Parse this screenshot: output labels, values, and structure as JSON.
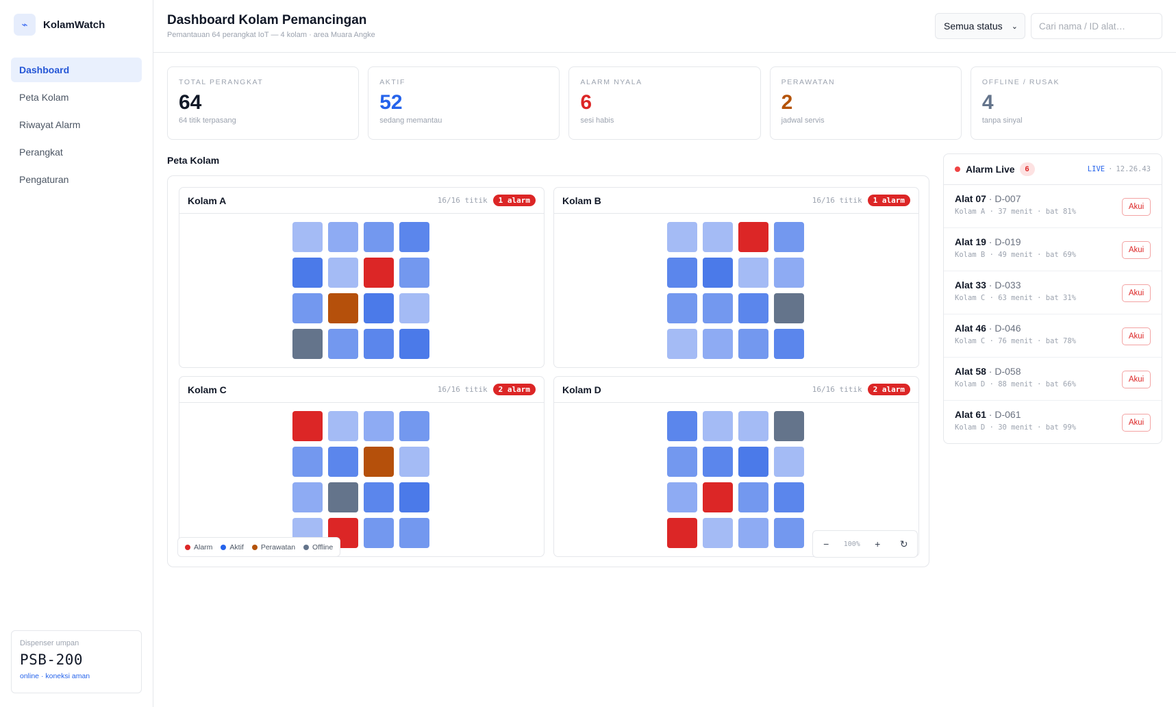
{
  "brand": {
    "name": "KolamWatch",
    "logo_icon": "wave-icon"
  },
  "sidebar": {
    "items": [
      {
        "label": "Dashboard",
        "active": true
      },
      {
        "label": "Peta Kolam"
      },
      {
        "label": "Riwayat Alarm"
      },
      {
        "label": "Perangkat"
      },
      {
        "label": "Pengaturan"
      }
    ],
    "dispenser": {
      "label": "Dispenser umpan",
      "model": "PSB-200",
      "status": "online · koneksi aman"
    }
  },
  "header": {
    "title": "Dashboard Kolam Pemancingan",
    "subtitle": "Pemantauan 64 perangkat IoT — 4 kolam · area Muara Angke",
    "status_filter": "Semua status",
    "search_placeholder": "Cari nama / ID alat…"
  },
  "stats": [
    {
      "label": "TOTAL PERANGKAT",
      "value": "64",
      "desc": "64 titik terpasang",
      "color": "#111827"
    },
    {
      "label": "AKTIF",
      "value": "52",
      "desc": "sedang memantau",
      "color": "#2563eb"
    },
    {
      "label": "ALARM NYALA",
      "value": "6",
      "desc": "sesi habis",
      "color": "#dc2626"
    },
    {
      "label": "PERAWATAN",
      "value": "2",
      "desc": "jadwal servis",
      "color": "#b45309"
    },
    {
      "label": "OFFLINE / RUSAK",
      "value": "4",
      "desc": "tanpa sinyal",
      "color": "#64748b"
    }
  ],
  "map": {
    "title": "Peta Kolam",
    "colors": {
      "alarm": "#dc2626",
      "maintenance": "#b5500b",
      "offline": "#64748b",
      "active_1": "#a4bbf5",
      "active_2": "#8eabf3",
      "active_3": "#7398ef",
      "active_4": "#5b86ec",
      "active_5": "#4b7ae9"
    },
    "ponds": [
      {
        "name": "Kolam A",
        "count": "16/16 titik",
        "badge": "1 alarm",
        "cells": [
          "a1",
          "a2",
          "a3",
          "a4",
          "a5",
          "a1",
          "alarm",
          "a3",
          "a3",
          "maint",
          "a5",
          "a1",
          "offline",
          "a3",
          "a4",
          "a5"
        ]
      },
      {
        "name": "Kolam B",
        "count": "16/16 titik",
        "badge": "1 alarm",
        "cells": [
          "a1",
          "a1",
          "alarm",
          "a3",
          "a4",
          "a5",
          "a1",
          "a2",
          "a3",
          "a3",
          "a4",
          "offline",
          "a1",
          "a2",
          "a3",
          "a4"
        ]
      },
      {
        "name": "Kolam C",
        "count": "16/16 titik",
        "badge": "2 alarm",
        "cells": [
          "alarm",
          "a1",
          "a2",
          "a3",
          "a3",
          "a4",
          "maint",
          "a1",
          "a2",
          "offline",
          "a4",
          "a5",
          "a1",
          "alarm",
          "a3",
          "a3"
        ]
      },
      {
        "name": "Kolam D",
        "count": "16/16 titik",
        "badge": "2 alarm",
        "cells": [
          "a4",
          "a1",
          "a1",
          "offline",
          "a3",
          "a4",
          "a5",
          "a1",
          "a2",
          "alarm",
          "a3",
          "a4",
          "alarm",
          "a1",
          "a2",
          "a3"
        ]
      }
    ],
    "legend": [
      {
        "label": "Alarm",
        "color": "#dc2626"
      },
      {
        "label": "Aktif",
        "color": "#2563eb"
      },
      {
        "label": "Perawatan",
        "color": "#b45309"
      },
      {
        "label": "Offline",
        "color": "#64748b"
      }
    ],
    "zoom": {
      "minus": "−",
      "level": "100%",
      "plus": "+",
      "reset_icon": "reset-icon"
    }
  },
  "alarm_panel": {
    "title": "Alarm Live",
    "count": "6",
    "live": "LIVE",
    "separator": "·",
    "time": "12.26.43",
    "items": [
      {
        "name": "Alat 07",
        "id": "D-007",
        "meta": "Kolam A · 37 menit · bat 81%",
        "action": "Akui"
      },
      {
        "name": "Alat 19",
        "id": "D-019",
        "meta": "Kolam B · 49 menit · bat 69%",
        "action": "Akui"
      },
      {
        "name": "Alat 33",
        "id": "D-033",
        "meta": "Kolam C · 63 menit · bat 31%",
        "action": "Akui"
      },
      {
        "name": "Alat 46",
        "id": "D-046",
        "meta": "Kolam C · 76 menit · bat 78%",
        "action": "Akui"
      },
      {
        "name": "Alat 58",
        "id": "D-058",
        "meta": "Kolam D · 88 menit · bat 66%",
        "action": "Akui"
      },
      {
        "name": "Alat 61",
        "id": "D-061",
        "meta": "Kolam D · 30 menit · bat 99%",
        "action": "Akui"
      }
    ]
  }
}
